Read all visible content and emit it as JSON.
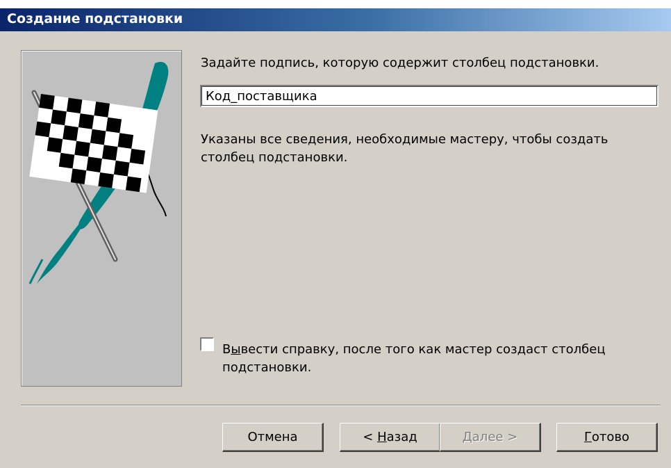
{
  "window": {
    "title": "Создание подстановки"
  },
  "main": {
    "prompt": "Задайте подпись, которую содержит столбец подстановки.",
    "caption_value": "Код_поставщика",
    "info": "Указаны все сведения, необходимые мастеру, чтобы создать столбец подстановки.",
    "help_checkbox": {
      "checked": false,
      "label_accel": "ы",
      "label_before": "В",
      "label_after": "вести справку, после того как мастер создаст столбец подстановки."
    }
  },
  "buttons": {
    "cancel": "Отмена",
    "back_prefix": "< ",
    "back_accel": "Н",
    "back_rest": "азад",
    "next_accel": "Д",
    "next_rest": "алее >",
    "finish_accel": "Г",
    "finish_rest": "отово"
  },
  "illustration": {
    "icon": "checkered-flag-icon",
    "accent_color": "#008080"
  }
}
